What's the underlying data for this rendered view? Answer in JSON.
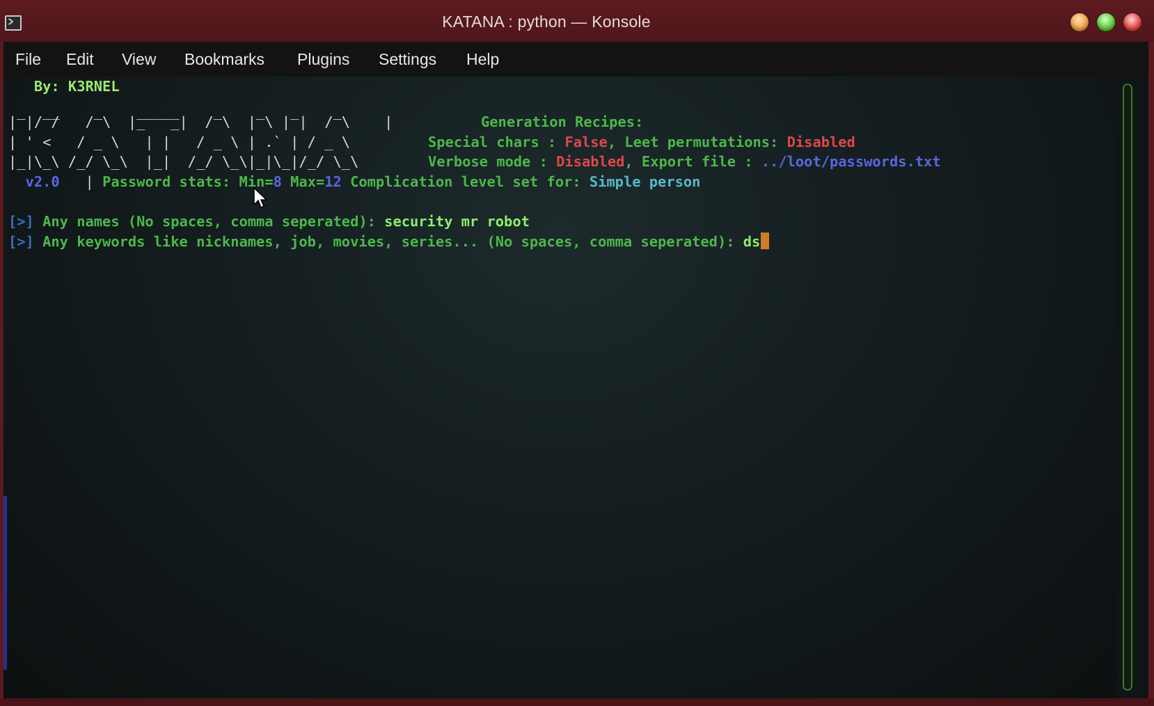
{
  "window": {
    "title": "KATANA : python — Konsole"
  },
  "menu": {
    "items": [
      "File",
      "Edit",
      "View",
      "Bookmarks",
      "Plugins",
      "Settings",
      "Help"
    ]
  },
  "terminal": {
    "author": "   By: K3RNEL",
    "ascii_1": " _  __    _    _____    _    _   _    _",
    "ascii_2": "| |/ /   / \\  |_   _|  / \\  | \\ | |  / \\    |",
    "ascii_3": "| ' <   / _ \\   | |   / _ \\ | .` | / _ \\",
    "ascii_4": "|_|\\_\\ /_/ \\_\\  |_|  /_/ \\_\\|_|\\_|/_/ \\_\\",
    "recipes_label": "Generation Recipes:",
    "special_chars_label": "Special chars : ",
    "special_chars_value": "False",
    "leet_label": ", Leet permutations: ",
    "leet_value": "Disabled",
    "verbose_label": "Verbose mode : ",
    "verbose_value": "Disabled",
    "export_label": ", Export file : ",
    "export_value": "../loot/passwords.txt",
    "version": "  v2.0",
    "stats_sep": "   | ",
    "stats_label": "Password stats: ",
    "min_label": "Min=",
    "min_value": "8",
    "max_label": " Max=",
    "max_value": "12",
    "complication_label": " Complication level set for: ",
    "complication_value": "Simple person",
    "prompt_marker": "[>]",
    "q1_text": " Any names (No spaces, comma seperated): ",
    "q1_answer": "security mr robot",
    "q2_text": " Any keywords like nicknames, job, movies, series... (No spaces, comma seperated): ",
    "q2_answer": "ds"
  },
  "colors": {
    "green": "#4cb84a",
    "red": "#e0474c",
    "blue": "#5b66e0",
    "cyan": "#58b8c8",
    "cursor": "#d07a2a",
    "titlebar": "#5a1a1e"
  }
}
